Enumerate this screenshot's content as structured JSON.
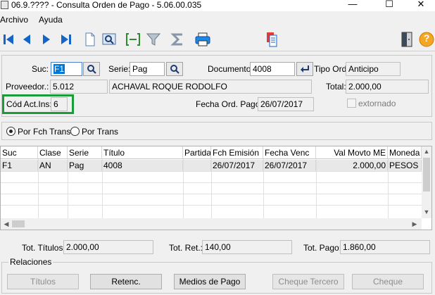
{
  "window": {
    "title": "06.9.???? - Consulta Orden de Pago - 5.06.00.035",
    "minimize": "—",
    "maximize": "☐",
    "close": "✕"
  },
  "menu": [
    "Archivo",
    "Ayuda"
  ],
  "toolbar": {
    "icons": [
      "first-record-icon",
      "previous-record-icon",
      "next-record-icon",
      "last-record-icon",
      "new-document-icon",
      "preview-icon",
      "select-range-icon",
      "filter-icon",
      "sum-icon",
      "print-icon",
      "documents-icon",
      "exit-door-icon",
      "help-icon"
    ],
    "help_label": "?"
  },
  "header": {
    "suc_label": "Suc:",
    "suc_value": "F1",
    "serie_label": "Serie:",
    "serie_value": "Pag",
    "documento_label": "Documento:",
    "documento_value": "4008",
    "tipo_ord_label": "Tipo Ord:",
    "tipo_ord_value": "Anticipo",
    "proveedor_label": "Proveedor.:",
    "proveedor_code": "5.012",
    "proveedor_name": "ACHAVAL ROQUE RODOLFO",
    "total_label": "Total:",
    "total_value": "2.000,00",
    "cod_act_label": "Cód Act.Ins:",
    "cod_act_value": "6",
    "fecha_label": "Fecha Ord. Pago:",
    "fecha_value": "26/07/2017",
    "extornado_label": "extornado"
  },
  "sort": {
    "option1": "Por Fch Trans",
    "option2": "Por Trans",
    "selected": "Por Fch Trans"
  },
  "grid": {
    "columns": [
      "Suc",
      "Clase",
      "Serie",
      "Título",
      "Partida",
      "Fch Emisión",
      "Fecha Venc",
      "Val Movto ME",
      "Moneda"
    ],
    "rows": [
      [
        "F1",
        "AN",
        "Pag",
        "4008",
        "",
        "26/07/2017",
        "26/07/2017",
        "2.000,00",
        "PESOS"
      ]
    ]
  },
  "totals": {
    "titulos_label": "Tot. Títulos:",
    "titulos_value": "2.000,00",
    "ret_label": "Tot. Ret.:",
    "ret_value": "140,00",
    "pago_label": "Tot. Pago:",
    "pago_value": "1.860,00"
  },
  "relaciones": {
    "label": "Relaciones",
    "buttons": [
      "Títulos",
      "Retenc.",
      "Medios de Pago",
      "Cheque Tercero",
      "Cheque"
    ]
  },
  "colors": {
    "highlight": "#1a9c3a",
    "selection": "#0078d7",
    "blue_icon": "#1565c8"
  }
}
